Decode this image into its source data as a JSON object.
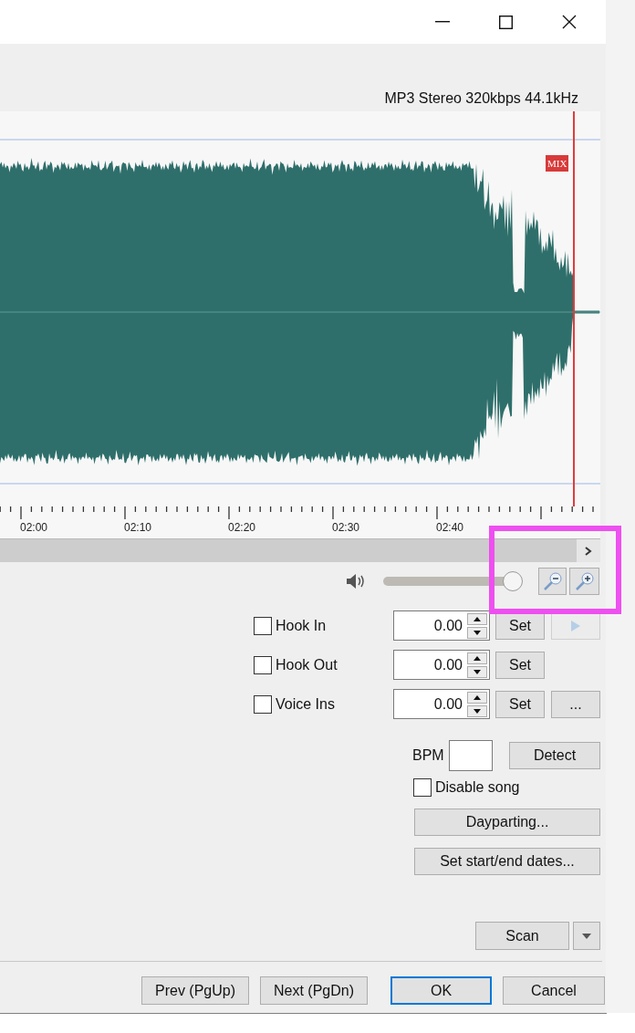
{
  "format_info": "MP3 Stereo 320kbps 44.1kHz",
  "waveform": {
    "marker_label": "MIX"
  },
  "timeline": {
    "labels": [
      "02:00",
      "02:10",
      "02:20",
      "02:30",
      "02:40"
    ]
  },
  "volume": {
    "level": 0.94
  },
  "cue_points": [
    {
      "label": "Hook In",
      "checked": false,
      "value": "0.00",
      "set_label": "Set",
      "extra": {
        "kind": "play",
        "disabled": true
      }
    },
    {
      "label": "Hook Out",
      "checked": false,
      "value": "0.00",
      "set_label": "Set",
      "extra": {
        "kind": "none"
      }
    },
    {
      "label": "Voice Ins",
      "checked": false,
      "value": "0.00",
      "set_label": "Set",
      "extra": {
        "kind": "text",
        "label": "...",
        "disabled": false
      }
    }
  ],
  "bpm": {
    "label": "BPM",
    "detect_label": "Detect"
  },
  "disable_song": {
    "label": "Disable song",
    "checked": false
  },
  "buttons": [
    "Dayparting...",
    "Set start/end dates..."
  ],
  "scan": {
    "label": "Scan"
  },
  "footer_buttons": [
    {
      "label": "Prev (PgUp)",
      "default": false
    },
    {
      "label": "Next (PgDn)",
      "default": false
    },
    {
      "label": "OK",
      "default": true
    },
    {
      "label": "Cancel",
      "default": false
    }
  ]
}
